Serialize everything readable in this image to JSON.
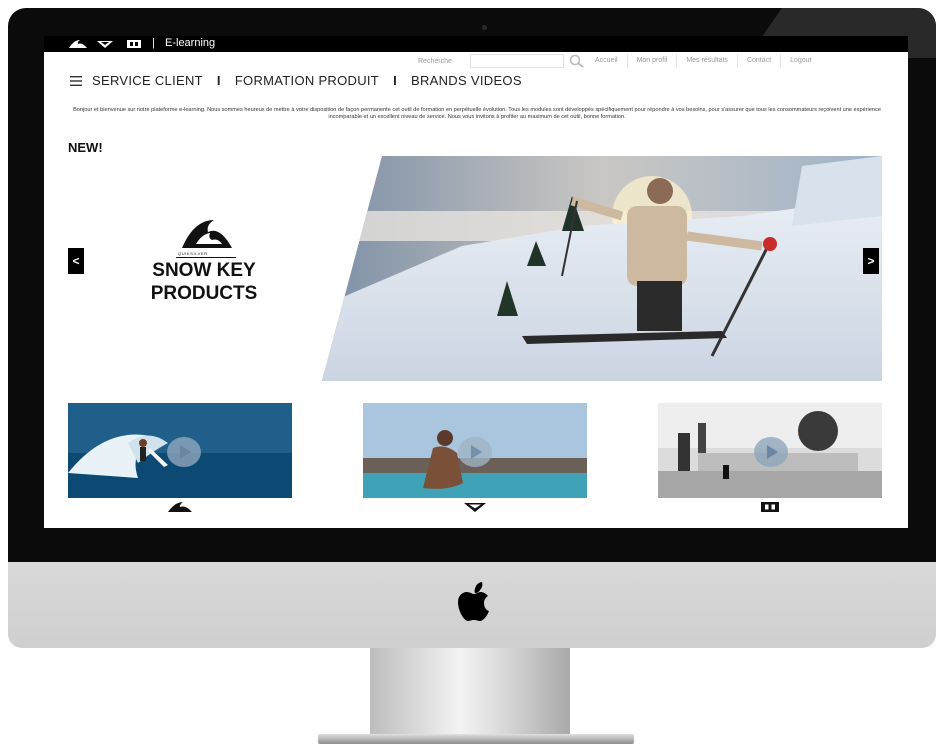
{
  "topbar": {
    "title": "E-learning",
    "separator": "|",
    "brand_icons": [
      "quiksilver-mountain-icon",
      "roxy-heart-icon",
      "dc-logo-icon"
    ]
  },
  "utility_nav": {
    "search_label": "Recherche",
    "search_value": "",
    "links": [
      "Accueil",
      "Mon profil",
      "Mes résultats",
      "Contact",
      "Logout"
    ]
  },
  "main_nav": {
    "items": [
      "SERVICE CLIENT",
      "FORMATION PRODUIT",
      "BRANDS VIDEOS"
    ],
    "divider": "I"
  },
  "intro_text": "Bonjour et bienvenue sur notre plateforme e-learning. Nous sommes heureux de mettre à votre disposition de façon permanente cet outil de formation en perpétuelle évolution. Tous les modules sont développés spécifiquement pour répondre à vos besoins, pour s'assurer que tous les consommateurs reçoivent une expérience incomparable et un excellent niveau de service. Nous vous invitons à profiter au maximum de cet outil, bonne formation.",
  "new_label": "NEW!",
  "hero": {
    "brand_word": "QUIKSILVER",
    "line1": "SNOW KEY",
    "line2": "PRODUCTS",
    "prev": "<",
    "next": ">"
  },
  "videos": [
    {
      "brand": "Quiksilver",
      "icon": "quiksilver-mountain-icon"
    },
    {
      "brand": "Roxy",
      "icon": "roxy-heart-icon"
    },
    {
      "brand": "DC",
      "icon": "dc-logo-icon"
    }
  ],
  "colors": {
    "topbar": "#000000",
    "text": "#222222",
    "link": "#999999",
    "bezel": "#0b0b0b",
    "chin": "#d4d4d4"
  }
}
